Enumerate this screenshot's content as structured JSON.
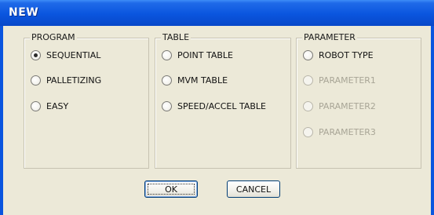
{
  "window": {
    "title": "NEW"
  },
  "groups": {
    "program": {
      "legend": "PROGRAM",
      "options": [
        {
          "label": "SEQUENTIAL",
          "checked": true,
          "enabled": true
        },
        {
          "label": "PALLETIZING",
          "checked": false,
          "enabled": true
        },
        {
          "label": "EASY",
          "checked": false,
          "enabled": true
        }
      ]
    },
    "table": {
      "legend": "TABLE",
      "options": [
        {
          "label": "POINT TABLE",
          "checked": false,
          "enabled": true
        },
        {
          "label": "MVM TABLE",
          "checked": false,
          "enabled": true
        },
        {
          "label": "SPEED/ACCEL TABLE",
          "checked": false,
          "enabled": true
        }
      ]
    },
    "parameter": {
      "legend": "PARAMETER",
      "options": [
        {
          "label": "ROBOT TYPE",
          "checked": false,
          "enabled": true
        },
        {
          "label": "PARAMETER1",
          "checked": false,
          "enabled": false
        },
        {
          "label": "PARAMETER2",
          "checked": false,
          "enabled": false
        },
        {
          "label": "PARAMETER3",
          "checked": false,
          "enabled": false
        }
      ]
    }
  },
  "buttons": {
    "ok_label": "OK",
    "cancel_label": "CANCEL"
  },
  "colors": {
    "titlebar": "#0a55df",
    "dialog_background": "#ece9d8",
    "disabled_text": "#a8a596",
    "button_border": "#003c74"
  }
}
